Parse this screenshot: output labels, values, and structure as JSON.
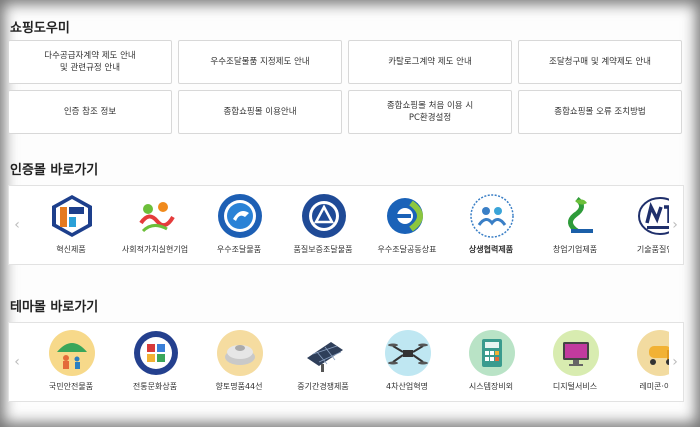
{
  "sections": {
    "shopping_guide": {
      "title": "쇼핑도우미",
      "buttons": [
        "다수공급자계약 제도 안내\n및 관련규정 안내",
        "우수조달물품 지정제도 안내",
        "카탈로그계약 제도 안내",
        "조달청구매 및 계약제도 안내",
        "인증 참조 정보",
        "종합쇼핑몰 이용안내",
        "종합쇼핑몰 처음 이용 시\nPC환경설정",
        "종합쇼핑몰 오류 조치방법"
      ]
    },
    "cert_mall": {
      "title": "인증몰 바로가기",
      "items": [
        {
          "label": "혁신제품",
          "icon": "innovation-product-icon"
        },
        {
          "label": "사회적가치실현기업",
          "icon": "social-value-icon"
        },
        {
          "label": "우수조달물품",
          "icon": "excellent-procurement-icon"
        },
        {
          "label": "품질보증조달물품",
          "icon": "quality-assurance-icon"
        },
        {
          "label": "우수조달공동상표",
          "icon": "joint-brand-icon"
        },
        {
          "label": "상생협력제품",
          "icon": "cooperation-product-icon"
        },
        {
          "label": "창업기업제품",
          "icon": "startup-icon"
        },
        {
          "label": "기술품질인증",
          "icon": "tech-quality-icon"
        }
      ]
    },
    "theme_mall": {
      "title": "테마몰 바로가기",
      "items": [
        {
          "label": "국민안전물품",
          "icon": "umbrella-family-icon"
        },
        {
          "label": "전통문화상품",
          "icon": "traditional-culture-icon"
        },
        {
          "label": "향토명품44선",
          "icon": "local-specialty-icon"
        },
        {
          "label": "중기간경쟁제품",
          "icon": "solar-panel-icon"
        },
        {
          "label": "4차산업혁명",
          "icon": "drone-icon"
        },
        {
          "label": "시스템장비외",
          "icon": "calculator-icon"
        },
        {
          "label": "디지털서비스",
          "icon": "monitor-icon"
        },
        {
          "label": "레미콘·아스",
          "icon": "concrete-truck-icon"
        }
      ]
    }
  },
  "arrows": {
    "left": "‹",
    "right": "›"
  }
}
